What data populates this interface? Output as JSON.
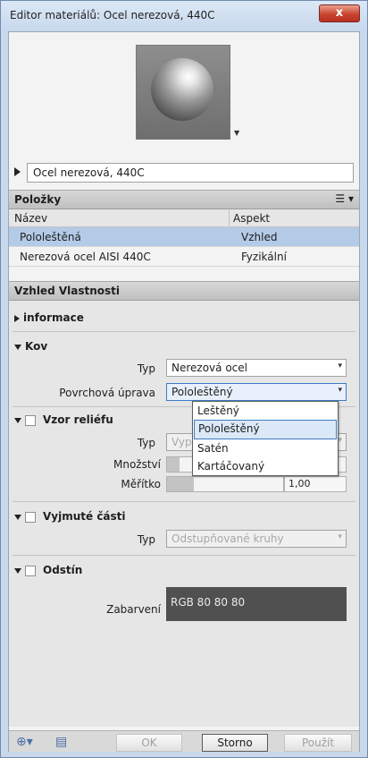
{
  "window": {
    "title": "Editor materiálů: Ocel nerezová, 440C",
    "close_glyph": "x"
  },
  "preview": {
    "dropdown_glyph": "▼"
  },
  "material": {
    "name": "Ocel nerezová, 440C"
  },
  "items_section": {
    "header": "Položky",
    "columns": [
      "Název",
      "Aspekt"
    ],
    "rows": [
      {
        "name": "Pololeštěná",
        "aspect": "Vzhled",
        "selected": true
      },
      {
        "name": "Nerezová ocel AISI 440C",
        "aspect": "Fyzikální",
        "selected": false
      }
    ]
  },
  "properties": {
    "header": "Vzhled Vlastnosti",
    "info_group": "informace",
    "metal_group": {
      "title": "Kov",
      "type_label": "Typ",
      "type_value": "Nerezová ocel",
      "finish_label": "Povrchová úprava",
      "finish_value": "Pololeštěný",
      "finish_options": [
        "Leštěný",
        "Pololeštěný",
        "Satén",
        "Kartáčovaný"
      ],
      "finish_selected_index": 1
    },
    "relief_group": {
      "title": "Vzor reliéfu",
      "type_label": "Typ",
      "type_value": "Vypo",
      "amount_label": "Množství",
      "scale_label": "Měřítko",
      "scale_value": "1,00"
    },
    "cutout_group": {
      "title": "Vyjmuté části",
      "type_label": "Typ",
      "type_value": "Odstupňované kruhy"
    },
    "tint_group": {
      "title": "Odstín",
      "color_label": "Zabarvení",
      "color_value": "RGB 80 80 80",
      "color_hex": "#505050"
    }
  },
  "footer": {
    "ok": "OK",
    "cancel": "Storno",
    "apply": "Použít"
  }
}
